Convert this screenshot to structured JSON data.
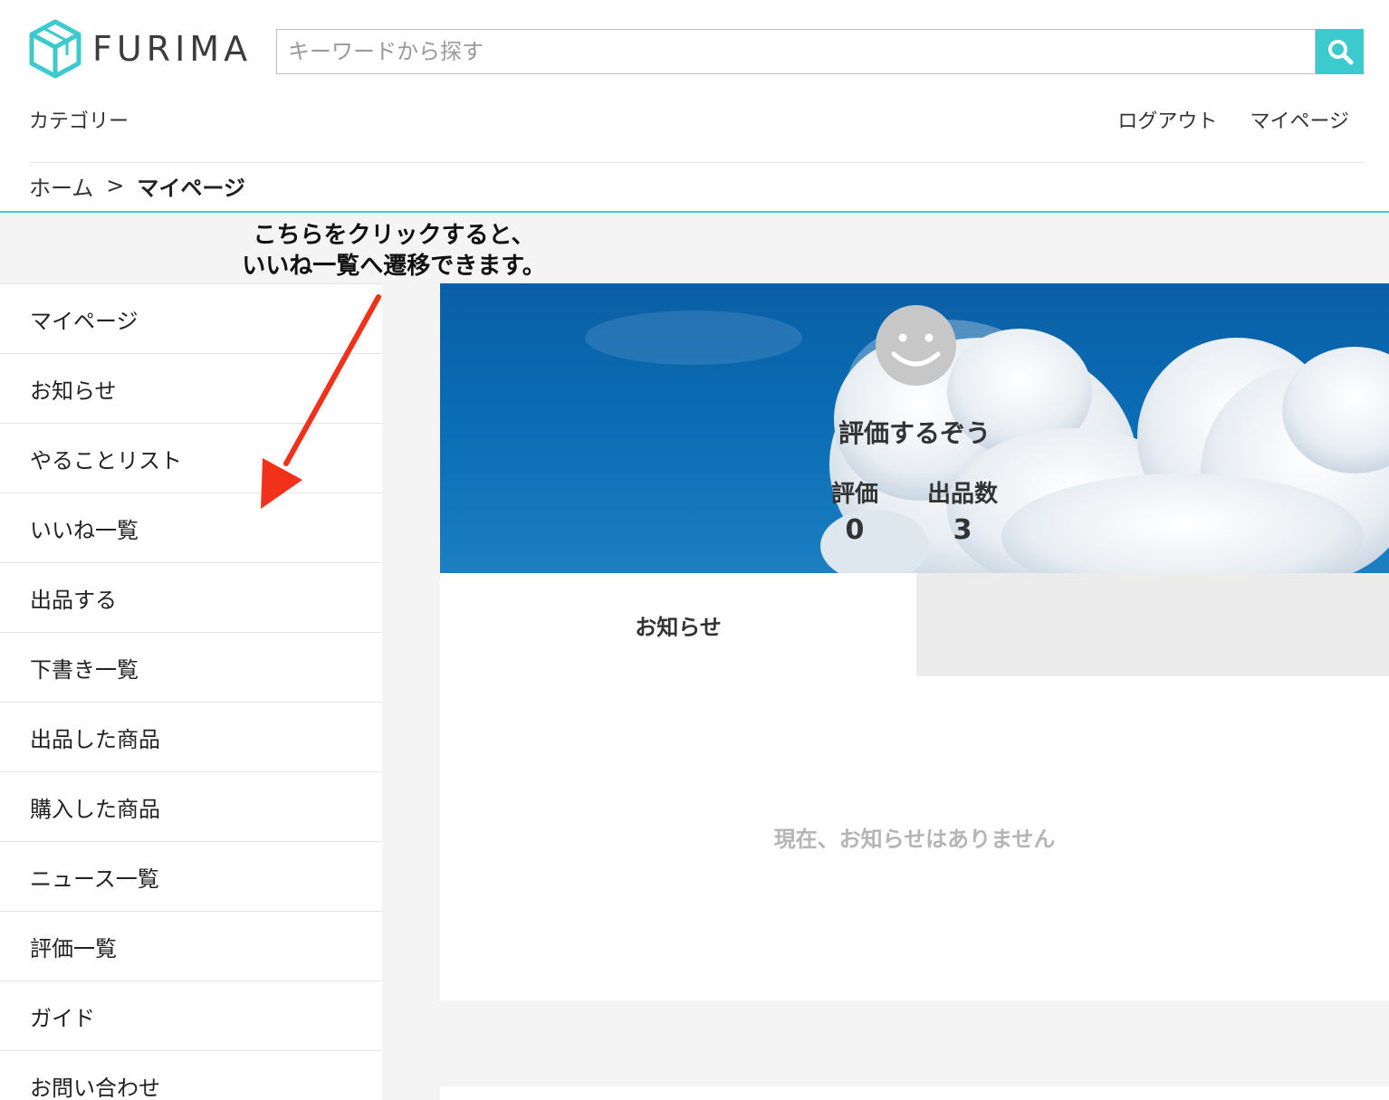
{
  "header": {
    "logo_text": "FURIMA",
    "search_placeholder": "キーワードから探す",
    "category_label": "カテゴリー",
    "logout_label": "ログアウト",
    "mypage_label": "マイページ"
  },
  "breadcrumb": {
    "home": "ホーム",
    "separator": ">",
    "current": "マイページ"
  },
  "annotation": {
    "line1": "こちらをクリックすると、",
    "line2": "いいね一覧へ遷移できます。"
  },
  "sidebar": {
    "items": [
      {
        "label": "マイページ"
      },
      {
        "label": "お知らせ"
      },
      {
        "label": "やることリスト"
      },
      {
        "label": "いいね一覧"
      },
      {
        "label": "出品する"
      },
      {
        "label": "下書き一覧"
      },
      {
        "label": "出品した商品"
      },
      {
        "label": "購入した商品"
      },
      {
        "label": "ニュース一覧"
      },
      {
        "label": "評価一覧"
      },
      {
        "label": "ガイド"
      },
      {
        "label": "お問い合わせ"
      }
    ]
  },
  "profile": {
    "username": "評価するぞう",
    "rating_label": "評価",
    "rating_value": "0",
    "listings_label": "出品数",
    "listings_value": "3"
  },
  "tabs": {
    "active_label": "お知らせ"
  },
  "notice": {
    "empty_message": "現在、お知らせはありません"
  },
  "colors": {
    "accent": "#3ccace",
    "arrow": "#f2311b"
  }
}
